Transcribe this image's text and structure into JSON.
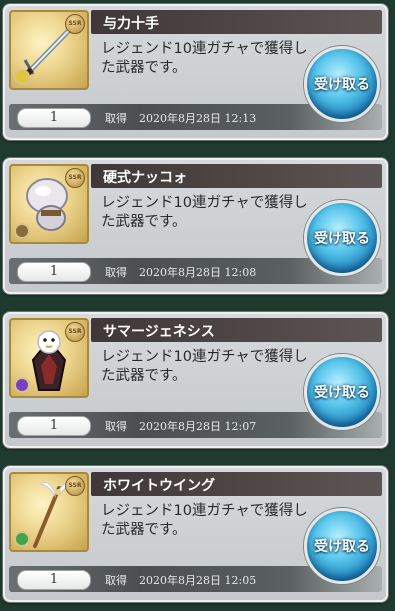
{
  "items": [
    {
      "name": "与力十手",
      "description": "レジェンド10連ガチャで獲得した武器です。",
      "count": "1",
      "acquired_label": "取得",
      "acquired_date": "2020年8月28日 12:13",
      "receive_label": "受け取る",
      "element_color": "#e1c53a",
      "weapon_icon": "jitte-weapon-icon"
    },
    {
      "name": "硬式ナッコォ",
      "description": "レジェンド10連ガチャで獲得した武器です。",
      "count": "1",
      "acquired_label": "取得",
      "acquired_date": "2020年8月28日 12:08",
      "receive_label": "受け取る",
      "element_color": "#8a6a3a",
      "weapon_icon": "knuckle-weapon-icon"
    },
    {
      "name": "サマージェネシス",
      "description": "レジェンド10連ガチャで獲得した武器です。",
      "count": "1",
      "acquired_label": "取得",
      "acquired_date": "2020年8月28日 12:07",
      "receive_label": "受け取る",
      "element_color": "#7a3fc0",
      "weapon_icon": "summer-genesis-weapon-icon"
    },
    {
      "name": "ホワイトウイング",
      "description": "レジェンド10連ガチャで獲得した武器です。",
      "count": "1",
      "acquired_label": "取得",
      "acquired_date": "2020年8月28日 12:05",
      "receive_label": "受け取る",
      "element_color": "#3fa54a",
      "weapon_icon": "white-wing-staff-icon"
    }
  ],
  "rarity_label": "SSR",
  "colors": {
    "background": "#1f3a2f",
    "title_bar": "#403838",
    "receive_button": "#54c3ea"
  }
}
